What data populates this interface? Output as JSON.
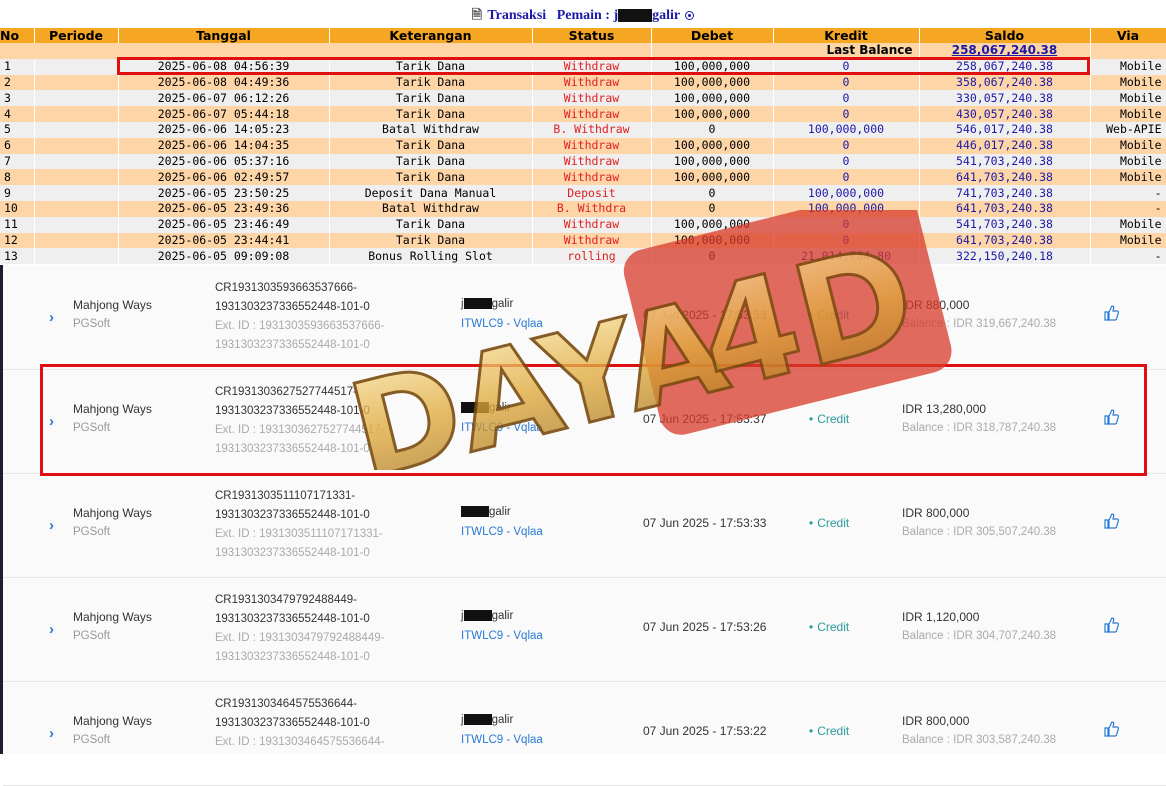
{
  "header": {
    "title_prefix": "Transaksi",
    "title_label": "Pemain :",
    "player_visible_a": "j",
    "player_visible_b": "galir"
  },
  "table": {
    "columns": [
      "No",
      "Periode",
      "Tanggal",
      "Keterangan",
      "Status",
      "Debet",
      "Kredit",
      "Saldo",
      "Via"
    ],
    "last_balance_label": "Last Balance",
    "last_balance_value": "258,067,240.38",
    "rows": [
      {
        "no": "1",
        "periode": "",
        "tanggal": "2025-06-08 04:56:39",
        "ket": "Tarik Dana",
        "status": "Withdraw",
        "debet": "100,000,000",
        "kredit": "0",
        "saldo": "258,067,240.38",
        "via": "Mobile"
      },
      {
        "no": "2",
        "periode": "",
        "tanggal": "2025-06-08 04:49:36",
        "ket": "Tarik Dana",
        "status": "Withdraw",
        "debet": "100,000,000",
        "kredit": "0",
        "saldo": "358,067,240.38",
        "via": "Mobile"
      },
      {
        "no": "3",
        "periode": "",
        "tanggal": "2025-06-07 06:12:26",
        "ket": "Tarik Dana",
        "status": "Withdraw",
        "debet": "100,000,000",
        "kredit": "0",
        "saldo": "330,057,240.38",
        "via": "Mobile"
      },
      {
        "no": "4",
        "periode": "",
        "tanggal": "2025-06-07 05:44:18",
        "ket": "Tarik Dana",
        "status": "Withdraw",
        "debet": "100,000,000",
        "kredit": "0",
        "saldo": "430,057,240.38",
        "via": "Mobile"
      },
      {
        "no": "5",
        "periode": "",
        "tanggal": "2025-06-06 14:05:23",
        "ket": "Batal Withdraw",
        "status": "B. Withdraw",
        "debet": "0",
        "kredit": "100,000,000",
        "saldo": "546,017,240.38",
        "via": "Web-APIE"
      },
      {
        "no": "6",
        "periode": "",
        "tanggal": "2025-06-06 14:04:35",
        "ket": "Tarik Dana",
        "status": "Withdraw",
        "debet": "100,000,000",
        "kredit": "0",
        "saldo": "446,017,240.38",
        "via": "Mobile"
      },
      {
        "no": "7",
        "periode": "",
        "tanggal": "2025-06-06 05:37:16",
        "ket": "Tarik Dana",
        "status": "Withdraw",
        "debet": "100,000,000",
        "kredit": "0",
        "saldo": "541,703,240.38",
        "via": "Mobile"
      },
      {
        "no": "8",
        "periode": "",
        "tanggal": "2025-06-06 02:49:57",
        "ket": "Tarik Dana",
        "status": "Withdraw",
        "debet": "100,000,000",
        "kredit": "0",
        "saldo": "641,703,240.38",
        "via": "Mobile"
      },
      {
        "no": "9",
        "periode": "",
        "tanggal": "2025-06-05 23:50:25",
        "ket": "Deposit Dana Manual",
        "status": "Deposit",
        "debet": "0",
        "kredit": "100,000,000",
        "saldo": "741,703,240.38",
        "via": "-"
      },
      {
        "no": "10",
        "periode": "",
        "tanggal": "2025-06-05 23:49:36",
        "ket": "Batal Withdraw",
        "status": "B. Withdra",
        "debet": "0",
        "kredit": "100,000,000",
        "saldo": "641,703,240.38",
        "via": "-"
      },
      {
        "no": "11",
        "periode": "",
        "tanggal": "2025-06-05 23:46:49",
        "ket": "Tarik Dana",
        "status": "Withdraw",
        "debet": "100,000,000",
        "kredit": "0",
        "saldo": "541,703,240.38",
        "via": "Mobile"
      },
      {
        "no": "12",
        "periode": "",
        "tanggal": "2025-06-05 23:44:41",
        "ket": "Tarik Dana",
        "status": "Withdraw",
        "debet": "100,000,000",
        "kredit": "0",
        "saldo": "641,703,240.38",
        "via": "Mobile"
      },
      {
        "no": "13",
        "periode": "",
        "tanggal": "2025-06-05 09:09:08",
        "ket": "Bonus Rolling Slot",
        "status": "rolling",
        "debet": "0",
        "kredit": "21,014,784.80",
        "saldo": "322,150,240.18",
        "via": "-"
      }
    ]
  },
  "bets": [
    {
      "game": "Mahjong Ways",
      "provider": "PGSoft",
      "ref1": "CR1931303593663537666-",
      "ref2": "1931303237336552448-101-0",
      "ext1": "Ext. ID : 1931303593663537666-",
      "ext2": "1931303237336552448-101-0",
      "user_a": "j",
      "user_b": "galir",
      "agent": "ITWLC9 - Vqlaa",
      "datetime": "07 Jun 2025 - 17:53:53",
      "status": "Credit",
      "amount": "IDR 880,000",
      "balance": "Balance : IDR 319,667,240.38"
    },
    {
      "game": "Mahjong Ways",
      "provider": "PGSoft",
      "ref1": "CR1931303627527744517-",
      "ref2": "1931303237336552448-101-0",
      "ext1": "Ext. ID : 1931303627527744517-",
      "ext2": "1931303237336552448-101-0",
      "user_a": "",
      "user_b": "galir",
      "agent": "ITWLC9 - Vqlaa",
      "datetime": "07 Jun 2025 - 17:53:37",
      "status": "Credit",
      "amount": "IDR 13,280,000",
      "balance": "Balance : IDR 318,787,240.38"
    },
    {
      "game": "Mahjong Ways",
      "provider": "PGSoft",
      "ref1": "CR1931303511107171331-",
      "ref2": "1931303237336552448-101-0",
      "ext1": "Ext. ID : 1931303511107171331-",
      "ext2": "1931303237336552448-101-0",
      "user_a": "",
      "user_b": "galir",
      "agent": "ITWLC9 - Vqlaa",
      "datetime": "07 Jun 2025 - 17:53:33",
      "status": "Credit",
      "amount": "IDR 800,000",
      "balance": "Balance : IDR 305,507,240.38"
    },
    {
      "game": "Mahjong Ways",
      "provider": "PGSoft",
      "ref1": "CR1931303479792488449-",
      "ref2": "1931303237336552448-101-0",
      "ext1": "Ext. ID : 1931303479792488449-",
      "ext2": "1931303237336552448-101-0",
      "user_a": "j",
      "user_b": "galir",
      "agent": "ITWLC9 - Vqlaa",
      "datetime": "07 Jun 2025 - 17:53:26",
      "status": "Credit",
      "amount": "IDR 1,120,000",
      "balance": "Balance : IDR 304,707,240.38"
    },
    {
      "game": "Mahjong Ways",
      "provider": "PGSoft",
      "ref1": "CR1931303464575536644-",
      "ref2": "1931303237336552448-101-0",
      "ext1": "Ext. ID : 1931303464575536644-",
      "ext2": "",
      "user_a": "j",
      "user_b": "galir",
      "agent": "ITWLC9 - Vqlaa",
      "datetime": "07 Jun 2025 - 17:53:22",
      "status": "Credit",
      "amount": "IDR 800,000",
      "balance": "Balance : IDR 303,587,240.38"
    }
  ],
  "watermark": {
    "text": "DAYA 4D",
    "colors": {
      "gold": "#e9b94a",
      "red": "#d83a2a"
    }
  }
}
